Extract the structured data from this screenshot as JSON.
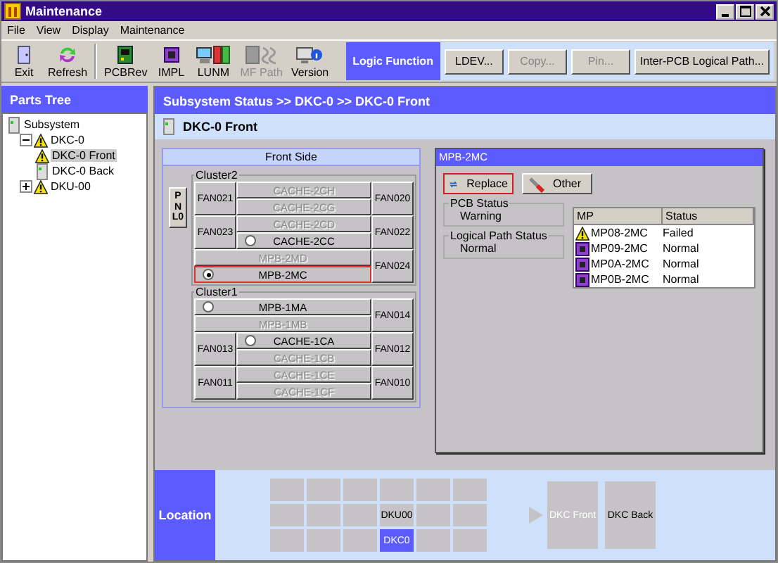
{
  "window": {
    "title": "Maintenance"
  },
  "menu": [
    "File",
    "View",
    "Display",
    "Maintenance"
  ],
  "toolbar": [
    {
      "label": "Exit",
      "kind": "exit",
      "enabled": true
    },
    {
      "label": "Refresh",
      "kind": "refresh",
      "enabled": true
    },
    {
      "label": "PCBRev",
      "kind": "pcb",
      "enabled": true
    },
    {
      "label": "IMPL",
      "kind": "chip",
      "enabled": true
    },
    {
      "label": "LUNM",
      "kind": "lunm",
      "enabled": true
    },
    {
      "label": "MF Path",
      "kind": "path",
      "enabled": false
    },
    {
      "label": "Version",
      "kind": "version",
      "enabled": true
    }
  ],
  "logic_function": {
    "title": "Logic Function",
    "buttons": [
      {
        "label": "LDEV...",
        "enabled": true
      },
      {
        "label": "Copy...",
        "enabled": false
      },
      {
        "label": "Pin...",
        "enabled": false
      },
      {
        "label": "Inter-PCB Logical Path...",
        "enabled": true
      }
    ]
  },
  "parts_tree": {
    "title": "Parts Tree",
    "items": [
      {
        "label": "Subsystem",
        "warning": false,
        "selected": false,
        "children": [
          {
            "label": "DKC-0",
            "expanded": true,
            "warning": true,
            "selected": false,
            "children": [
              {
                "label": "DKC-0 Front",
                "warning": true,
                "selected": true
              },
              {
                "label": "DKC-0 Back",
                "warning": false,
                "selected": false
              }
            ]
          },
          {
            "label": "DKU-00",
            "expanded": false,
            "warning": true,
            "selected": false
          }
        ]
      }
    ]
  },
  "breadcrumb": "Subsystem Status >> DKC-0 >> DKC-0 Front",
  "page_title": "DKC-0 Front",
  "front_side": {
    "title": "Front Side",
    "panel": "PNL0",
    "clusters": [
      {
        "title": "Cluster2",
        "groups": [
          {
            "left": "FAN021",
            "boards": [
              {
                "label": "CACHE-2CH",
                "enabled": false,
                "kind": "plain"
              },
              {
                "label": "CACHE-2CG",
                "enabled": false,
                "kind": "plain"
              }
            ],
            "right": "FAN020"
          },
          {
            "left": "FAN023",
            "boards": [
              {
                "label": "CACHE-2CD",
                "enabled": false,
                "kind": "plain"
              },
              {
                "label": "CACHE-2CC",
                "enabled": true,
                "kind": "selectable",
                "selected": false
              }
            ],
            "right": "FAN022"
          },
          {
            "boards": [
              {
                "label": "MPB-2MD",
                "enabled": false,
                "kind": "plain"
              },
              {
                "label": "MPB-2MC",
                "enabled": true,
                "kind": "selectable",
                "selected": true
              }
            ],
            "right": "FAN024"
          }
        ]
      },
      {
        "title": "Cluster1",
        "groups": [
          {
            "boards": [
              {
                "label": "MPB-1MA",
                "enabled": true,
                "kind": "selectable",
                "selected": false
              },
              {
                "label": "MPB-1MB",
                "enabled": false,
                "kind": "plain"
              }
            ],
            "right": "FAN014"
          },
          {
            "left": "FAN013",
            "boards": [
              {
                "label": "CACHE-1CA",
                "enabled": true,
                "kind": "selectable",
                "selected": false
              },
              {
                "label": "CACHE-1CB",
                "enabled": false,
                "kind": "plain"
              }
            ],
            "right": "FAN012"
          },
          {
            "left": "FAN011",
            "boards": [
              {
                "label": "CACHE-1CE",
                "enabled": false,
                "kind": "plain"
              },
              {
                "label": "CACHE-1CF",
                "enabled": false,
                "kind": "plain"
              }
            ],
            "right": "FAN010"
          }
        ]
      }
    ]
  },
  "detail": {
    "title": "MPB-2MC",
    "buttons": [
      {
        "label": "Replace",
        "kind": "replace",
        "focused": true
      },
      {
        "label": "Other",
        "kind": "other",
        "focused": false
      }
    ],
    "pcb_status": {
      "label": "PCB Status",
      "value": "Warning"
    },
    "logical_path_status": {
      "label": "Logical Path Status",
      "value": "Normal"
    },
    "table": {
      "columns": [
        "MP",
        "Status"
      ],
      "rows": [
        {
          "mp": "MP08-2MC",
          "status": "Failed",
          "warning": true
        },
        {
          "mp": "MP09-2MC",
          "status": "Normal",
          "warning": false
        },
        {
          "mp": "MP0A-2MC",
          "status": "Normal",
          "warning": false
        },
        {
          "mp": "MP0B-2MC",
          "status": "Normal",
          "warning": false
        }
      ]
    }
  },
  "location": {
    "title": "Location",
    "grid": [
      {
        "selected": false
      },
      {
        "selected": false
      },
      {
        "selected": false
      },
      {
        "selected": false
      },
      {
        "selected": false
      },
      {
        "selected": false
      },
      {
        "selected": false
      },
      {
        "selected": false
      },
      {
        "selected": false
      },
      {
        "label": "DKU00",
        "selected": false
      },
      {
        "selected": false
      },
      {
        "selected": false
      },
      {
        "selected": false
      },
      {
        "selected": false
      },
      {
        "selected": false
      },
      {
        "label": "DKC0",
        "selected": true
      },
      {
        "selected": false
      },
      {
        "selected": false
      }
    ],
    "views": [
      {
        "label": "DKC Front",
        "selected": true
      },
      {
        "label": "DKC Back",
        "selected": false
      }
    ]
  }
}
